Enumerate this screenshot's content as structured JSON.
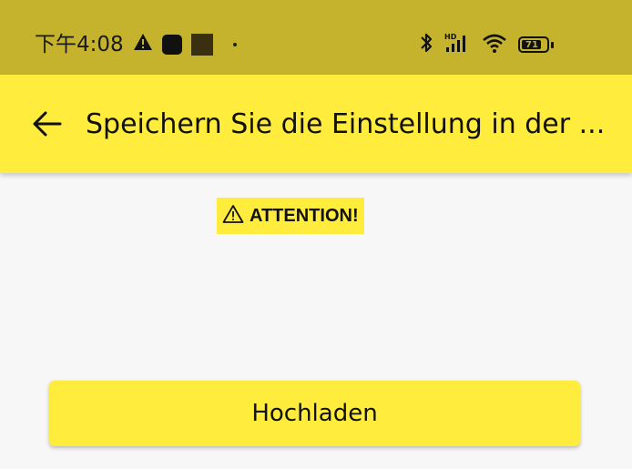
{
  "status_bar": {
    "time": "下午4:08",
    "battery_level": "71",
    "background_color": "#c5b32e",
    "icons": [
      "warning-icon",
      "notification-icon",
      "notification-icon",
      "dot-icon",
      "bluetooth-icon",
      "hd-signal-icon",
      "wifi-icon",
      "battery-icon"
    ]
  },
  "app_bar": {
    "title": "Speichern Sie die Einstellung in der ...",
    "back_icon": "arrow-left-icon",
    "background_color": "#ffec3d"
  },
  "main": {
    "attention_label": "ATTENTION!",
    "attention_icon": "warning-triangle-icon",
    "upload_button_label": "Hochladen"
  },
  "colors": {
    "accent": "#ffec3d",
    "background": "#f7f7f7"
  }
}
